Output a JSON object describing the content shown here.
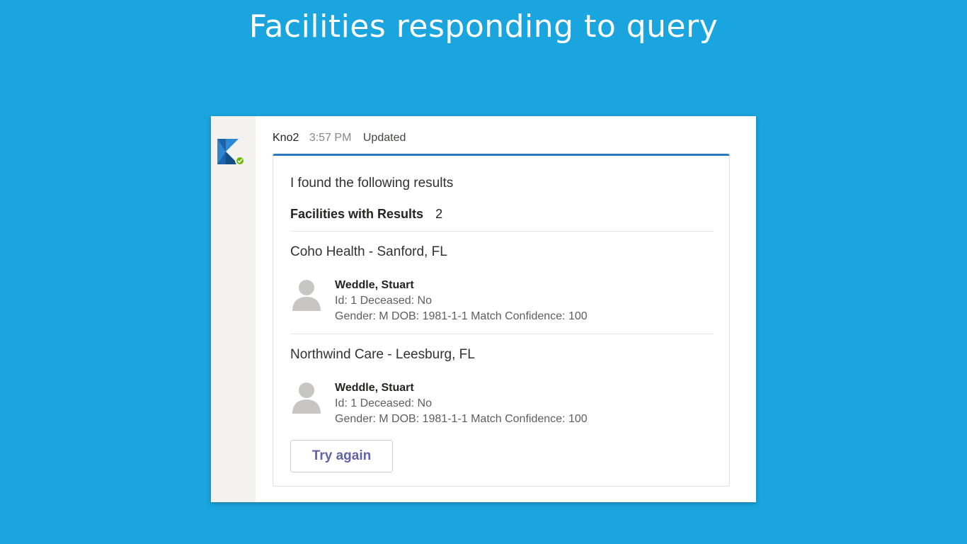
{
  "page": {
    "title": "Facilities responding to query"
  },
  "message": {
    "sender": "Kno2",
    "time": "3:57 PM",
    "status": "Updated"
  },
  "card": {
    "intro": "I found the following results",
    "summary_label": "Facilities with Results",
    "summary_count": "2",
    "facilities": [
      {
        "name": "Coho Health - Sanford, FL",
        "patient": {
          "name": "Weddle, Stuart",
          "line1": "Id: 1 Deceased: No",
          "line2": "Gender: M DOB: 1981-1-1 Match Confidence: 100"
        }
      },
      {
        "name": "Northwind Care - Leesburg, FL",
        "patient": {
          "name": "Weddle, Stuart",
          "line1": "Id: 1 Deceased: No",
          "line2": "Gender: M DOB: 1981-1-1 Match Confidence: 100"
        }
      }
    ],
    "action_label": "Try again"
  },
  "icons": {
    "bot_avatar": "kno2-logo-icon",
    "presence": "available-check-icon",
    "patient": "person-placeholder-icon"
  },
  "colors": {
    "background": "#1aa5df",
    "card_accent": "#2b78c5",
    "action_text": "#6264a7",
    "presence": "#6bb700"
  }
}
